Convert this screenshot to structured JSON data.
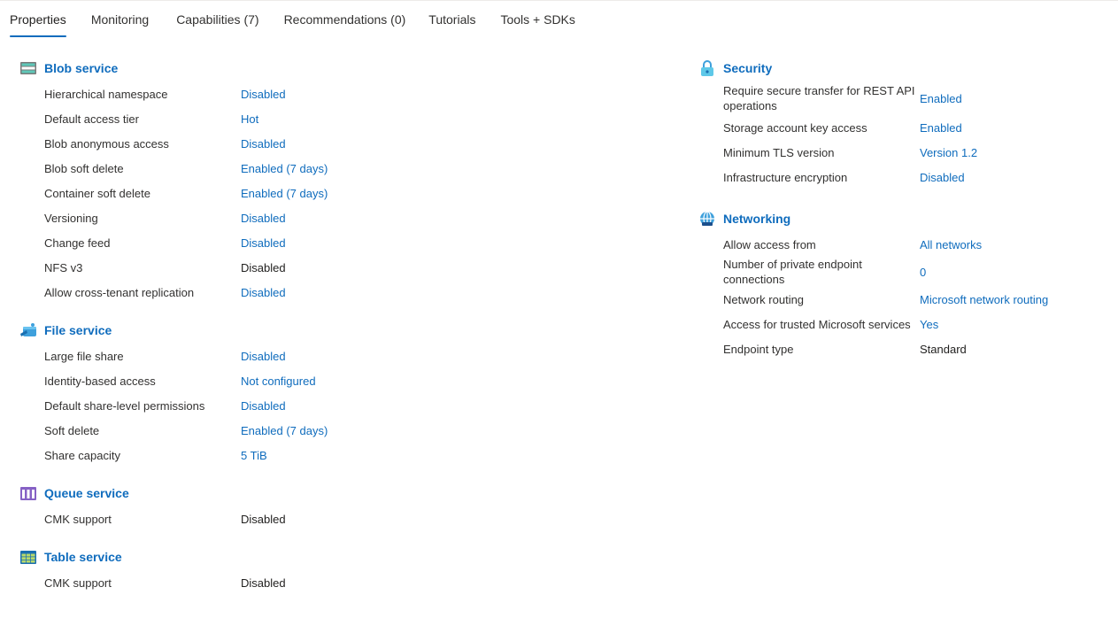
{
  "tabs": [
    {
      "label": "Properties",
      "active": true
    },
    {
      "label": "Monitoring",
      "active": false
    },
    {
      "label": "Capabilities (7)",
      "active": false
    },
    {
      "label": "Recommendations (0)",
      "active": false
    },
    {
      "label": "Tutorials",
      "active": false
    },
    {
      "label": "Tools + SDKs",
      "active": false
    }
  ],
  "blob": {
    "title": "Blob service",
    "icon": "blob-storage-icon",
    "rows": [
      {
        "label": "Hierarchical namespace",
        "value": "Disabled"
      },
      {
        "label": "Default access tier",
        "value": "Hot"
      },
      {
        "label": "Blob anonymous access",
        "value": "Disabled"
      },
      {
        "label": "Blob soft delete",
        "value": "Enabled (7 days)"
      },
      {
        "label": "Container soft delete",
        "value": "Enabled (7 days)"
      },
      {
        "label": "Versioning",
        "value": "Disabled"
      },
      {
        "label": "Change feed",
        "value": "Disabled"
      },
      {
        "label": "NFS v3",
        "value": "Disabled"
      },
      {
        "label": "Allow cross-tenant replication",
        "value": "Disabled"
      }
    ]
  },
  "file": {
    "title": "File service",
    "icon": "file-share-icon",
    "rows": [
      {
        "label": "Large file share",
        "value": "Disabled"
      },
      {
        "label": "Identity-based access",
        "value": "Not configured"
      },
      {
        "label": "Default share-level permissions",
        "value": "Disabled"
      },
      {
        "label": "Soft delete",
        "value": "Enabled (7 days)"
      },
      {
        "label": "Share capacity",
        "value": "5 TiB"
      }
    ]
  },
  "queue": {
    "title": "Queue service",
    "icon": "queue-icon",
    "rows": [
      {
        "label": "CMK support",
        "value": "Disabled"
      }
    ]
  },
  "table": {
    "title": "Table service",
    "icon": "table-icon",
    "rows": [
      {
        "label": "CMK support",
        "value": "Disabled"
      }
    ]
  },
  "security": {
    "title": "Security",
    "icon": "lock-icon",
    "rows": [
      {
        "label": "Require secure transfer for REST API operations",
        "value": "Enabled"
      },
      {
        "label": "Storage account key access",
        "value": "Enabled"
      },
      {
        "label": "Minimum TLS version",
        "value": "Version 1.2"
      },
      {
        "label": "Infrastructure encryption",
        "value": "Disabled"
      }
    ]
  },
  "networking": {
    "title": "Networking",
    "icon": "globe-network-icon",
    "rows": [
      {
        "label": "Allow access from",
        "value": "All networks"
      },
      {
        "label": "Number of private endpoint connections",
        "value": "0"
      },
      {
        "label": "Network routing",
        "value": "Microsoft network routing"
      },
      {
        "label": "Access for trusted Microsoft services",
        "value": "Yes"
      },
      {
        "label": "Endpoint type",
        "value": "Standard"
      }
    ]
  },
  "colors": {
    "accent": "#0f6cbd",
    "text": "#323130"
  }
}
